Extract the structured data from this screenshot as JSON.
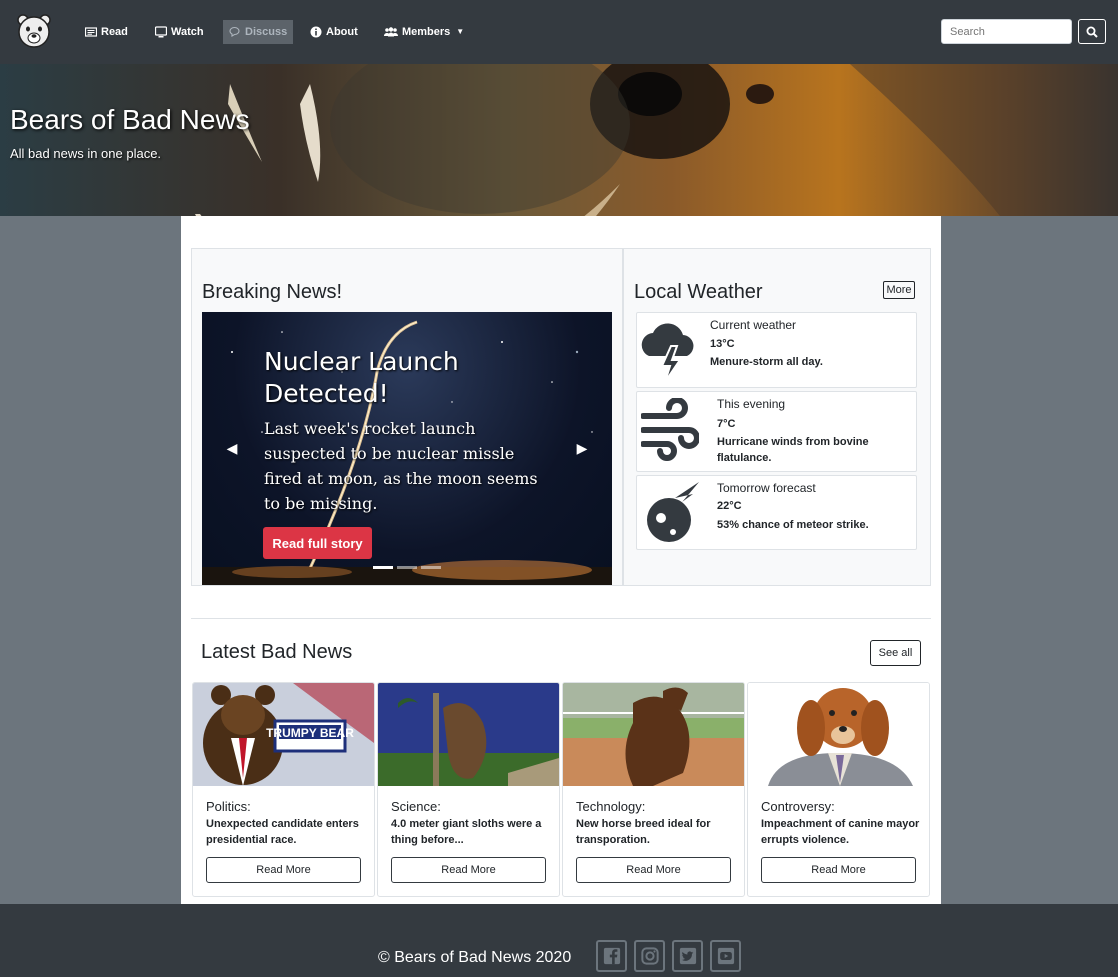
{
  "nav": {
    "items": [
      {
        "label": "Read",
        "icon": "newspaper-icon"
      },
      {
        "label": "Watch",
        "icon": "monitor-icon"
      },
      {
        "label": "Discuss",
        "icon": "chat-icon"
      },
      {
        "label": "About",
        "icon": "info-icon"
      },
      {
        "label": "Members",
        "icon": "users-icon"
      }
    ],
    "active": "Discuss",
    "search_placeholder": "Search"
  },
  "hero": {
    "title": "Bears of Bad News",
    "subtitle": "All bad news in one place."
  },
  "breaking": {
    "title": "Breaking News!",
    "slide_title": "Nuclear Launch Detected!",
    "slide_text": "Last week's rocket launch suspected to be nuclear missle fired at moon, as the moon seems to be missing.",
    "button": "Read full story",
    "slide_count": 3,
    "active_slide": 1
  },
  "weather": {
    "title": "Local Weather",
    "more": "More",
    "entries": [
      {
        "label": "Current weather",
        "temp": "13°C",
        "desc": "Menure-storm all day.",
        "icon": "storm-icon"
      },
      {
        "label": "This evening",
        "temp": "7°C",
        "desc": "Hurricane winds from bovine flatulance.",
        "icon": "wind-icon"
      },
      {
        "label": "Tomorrow forecast",
        "temp": "22°C",
        "desc": "53% chance of meteor strike.",
        "icon": "meteor-icon"
      }
    ]
  },
  "latest": {
    "title": "Latest Bad News",
    "see_all": "See all",
    "image_sign": "TRUMPY BEAR",
    "cards": [
      {
        "category": "Politics:",
        "text": "Unexpected candidate enters presidential race.",
        "button": "Read More"
      },
      {
        "category": "Science:",
        "text": "4.0 meter giant sloths were a thing before...",
        "button": "Read More"
      },
      {
        "category": "Technology:",
        "text": "New horse breed ideal for transporation.",
        "button": "Read More"
      },
      {
        "category": "Controversy:",
        "text": "Impeachment of canine mayor errupts violence.",
        "button": "Read More"
      }
    ]
  },
  "footer": {
    "text": "© Bears of Bad News 2020",
    "social": [
      "facebook-icon",
      "instagram-icon",
      "twitter-icon",
      "youtube-icon"
    ]
  }
}
